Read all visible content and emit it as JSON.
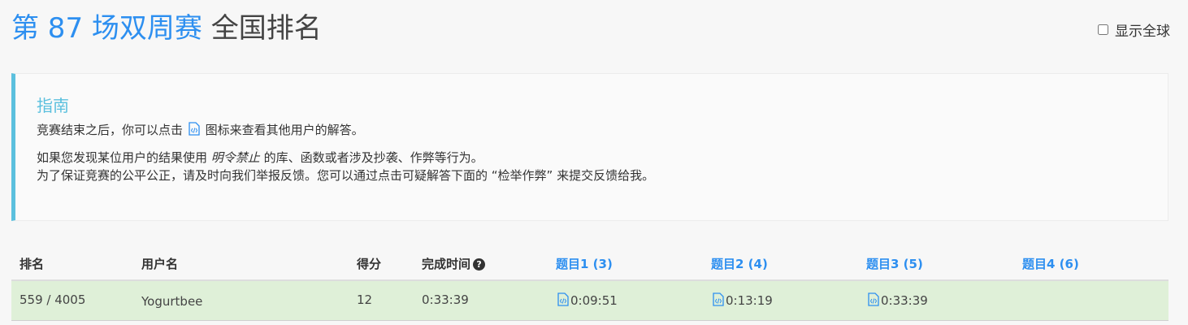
{
  "title": {
    "contest": "第 87 场双周赛",
    "ranking": "全国排名"
  },
  "global_toggle": {
    "label": "显示全球",
    "checked": false
  },
  "guide": {
    "heading": "指南",
    "line1_before": "竞赛结束之后，你可以点击",
    "line1_after": "图标来查看其他用户的解答。",
    "line2_before": "如果您发现某位用户的结果使用",
    "line2_em": "明令禁止",
    "line2_after": "的库、函数或者涉及抄袭、作弊等行为。",
    "line3": "为了保证竞赛的公平公正，请及时向我们举报反馈。您可以通过点击可疑解答下面的 “检举作弊” 来提交反馈给我。"
  },
  "table": {
    "headers": {
      "rank": "排名",
      "username": "用户名",
      "score": "得分",
      "finish_time": "完成时间",
      "q1": "题目1 (3)",
      "q2": "题目2 (4)",
      "q3": "题目3 (5)",
      "q4": "题目4 (6)"
    },
    "row": {
      "rank": "559 / 4005",
      "username": "Yogurtbee",
      "score": "12",
      "finish_time": "0:33:39",
      "q1": "0:09:51",
      "q2": "0:13:19",
      "q3": "0:33:39",
      "q4": ""
    }
  },
  "colors": {
    "accent": "#2d8ff0",
    "guide_border": "#5bc0de",
    "row_bg": "#dff0d8"
  },
  "icons": {
    "solution": "code-file-icon",
    "help": "question-circle-icon"
  }
}
